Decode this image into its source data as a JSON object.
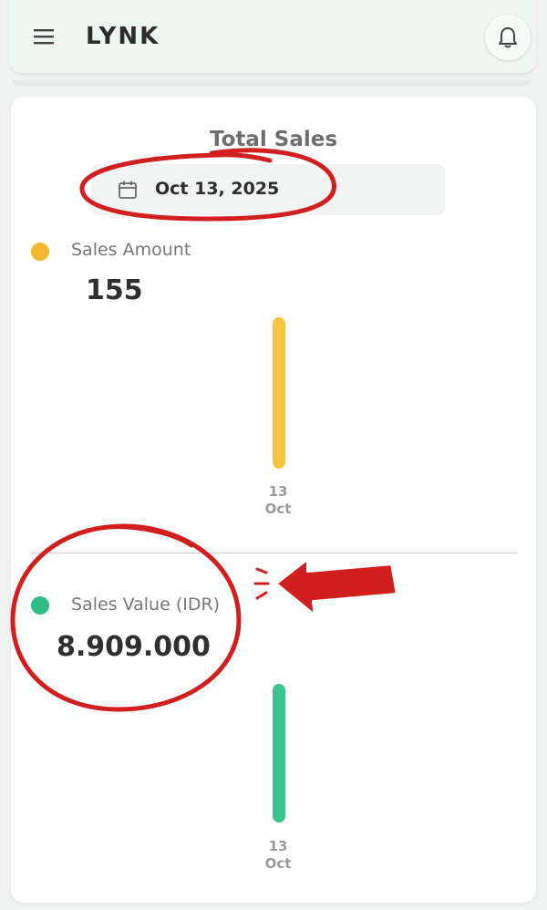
{
  "header": {
    "logo_text": "LYNK",
    "menu_icon": "hamburger-menu-icon",
    "notification_icon": "bell-icon"
  },
  "total_sales": {
    "title": "Total Sales",
    "date": "Oct 13, 2025",
    "date_icon": "calendar-icon"
  },
  "sales_amount": {
    "label": "Sales Amount",
    "value": "155",
    "dot_color": "#f5b731"
  },
  "sales_value": {
    "label": "Sales Value (IDR)",
    "value": "8.909.000",
    "dot_color": "#2fbf86"
  },
  "chart_data": [
    {
      "type": "bar",
      "categories": [
        "13 Oct"
      ],
      "values": [
        155
      ],
      "color": "#f5c542"
    },
    {
      "type": "bar",
      "categories": [
        "13 Oct"
      ],
      "values": [
        8909000
      ],
      "color": "#3cc48c"
    }
  ],
  "tick_day": "13",
  "tick_month": "Oct",
  "annotation_color": "#d11f1f"
}
